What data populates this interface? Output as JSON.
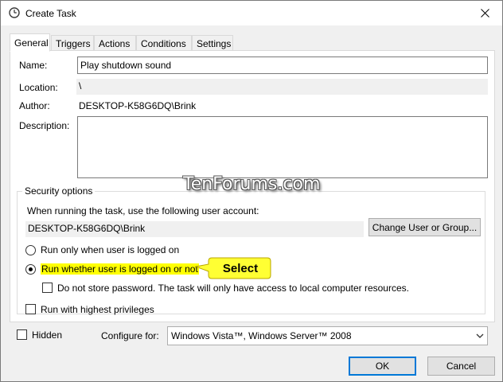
{
  "window": {
    "title": "Create Task"
  },
  "tabs": [
    {
      "label": "General",
      "active": true
    },
    {
      "label": "Triggers"
    },
    {
      "label": "Actions"
    },
    {
      "label": "Conditions"
    },
    {
      "label": "Settings"
    }
  ],
  "general": {
    "name_label": "Name:",
    "name_value": "Play shutdown sound",
    "location_label": "Location:",
    "location_value": "\\",
    "author_label": "Author:",
    "author_value": "DESKTOP-K58G6DQ\\Brink",
    "description_label": "Description:",
    "description_value": ""
  },
  "security": {
    "group_title": "Security options",
    "account_prompt": "When running the task, use the following user account:",
    "account_value": "DESKTOP-K58G6DQ\\Brink",
    "change_button": "Change User or Group...",
    "radio_logged_on": "Run only when user is logged on",
    "radio_whether": "Run whether user is logged on or not",
    "selected_radio": "radio_whether",
    "no_store_password": "Do not store password.  The task will only have access to local computer resources.",
    "no_store_password_checked": false,
    "highest_privileges": "Run with highest privileges",
    "highest_privileges_checked": false
  },
  "annotation": {
    "callout_text": "Select",
    "watermark": "TenForums.com"
  },
  "footer": {
    "hidden_label": "Hidden",
    "hidden_checked": false,
    "configure_label": "Configure for:",
    "configure_value": "Windows Vista™, Windows Server™ 2008",
    "ok_label": "OK",
    "cancel_label": "Cancel"
  },
  "colors": {
    "highlight": "#ffff00",
    "callout_fill": "#ffff33",
    "accent": "#0078d7"
  },
  "icons": {
    "title": "clock-icon",
    "close": "close-icon",
    "dropdown": "chevron-down-icon"
  }
}
